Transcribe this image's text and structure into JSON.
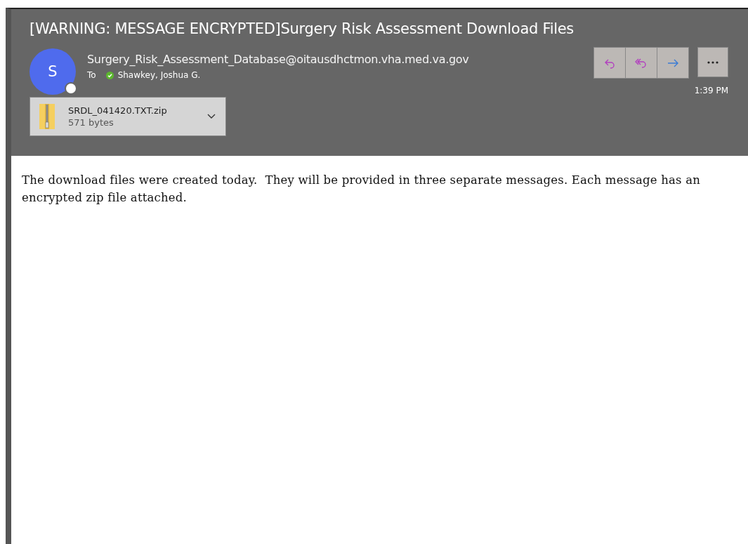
{
  "subject": "[WARNING: MESSAGE ENCRYPTED]Surgery Risk Assessment Download Files",
  "sender": {
    "initial": "S",
    "address": "Surgery_Risk_Assessment_Database@oitausdhctmon.vha.med.va.gov",
    "online": false
  },
  "recipient": {
    "label": "To",
    "name": "Shawkey, Joshua G.",
    "verified": true
  },
  "time": "1:39 PM",
  "actions": [
    {
      "kind": "reply"
    },
    {
      "kind": "reply-all"
    },
    {
      "kind": "forward"
    },
    {
      "kind": "more"
    }
  ],
  "attachment": {
    "name": "SRDL_041420.TXT.zip",
    "size": "571 bytes"
  },
  "body": "The download files were created today.  They will be provided in three separate messages. Each message has an encrypted zip file attached."
}
